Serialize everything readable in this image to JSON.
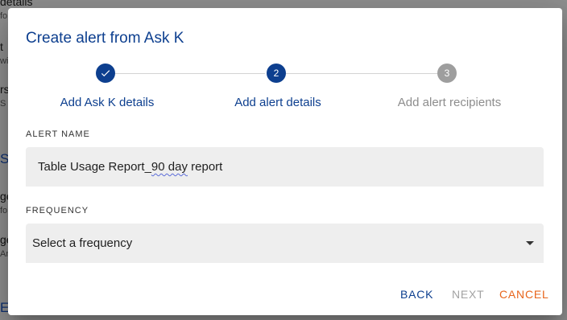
{
  "background": {
    "rows": [
      {
        "text": "details",
        "sub": "fo"
      },
      {
        "text": "t",
        "sub": "wi"
      },
      {
        "text": "rs",
        "sub": "S"
      },
      {
        "link": "S"
      },
      {
        "text": "ge",
        "sub": "fo"
      },
      {
        "text": "ge",
        "sub": "An"
      },
      {
        "link": "E"
      }
    ]
  },
  "dialog": {
    "title": "Create alert from Ask K",
    "steps": [
      {
        "number": "",
        "icon": "check-icon",
        "label": "Add Ask K details",
        "state": "completed"
      },
      {
        "number": "2",
        "label": "Add alert details",
        "state": "active"
      },
      {
        "number": "3",
        "label": "Add alert recipients",
        "state": "inactive"
      }
    ],
    "alert_name": {
      "label": "ALERT NAME",
      "value_prefix": "Table Usage Report_",
      "value_misspelled": "90 day",
      "value_suffix": " report"
    },
    "frequency": {
      "label": "FREQUENCY",
      "selected": "Select a frequency"
    },
    "actions": {
      "back": "BACK",
      "next": "NEXT",
      "cancel": "CANCEL"
    }
  },
  "colors": {
    "primary": "#0d3f8f",
    "inactive": "#9e9e9e",
    "cancel": "#e8651c",
    "field_bg": "#eeeeee"
  }
}
